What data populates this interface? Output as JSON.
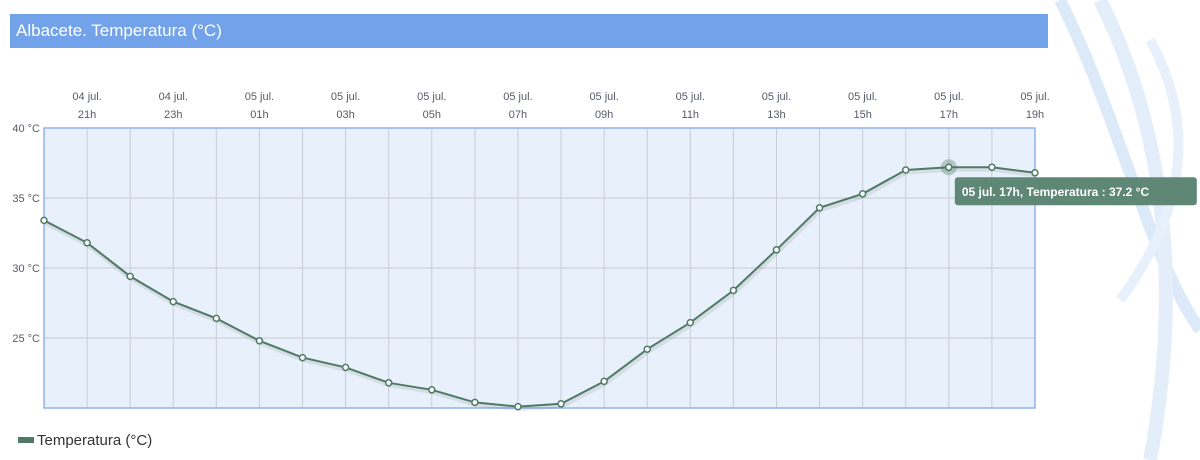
{
  "title": "Albacete. Temperatura (°C)",
  "legend": {
    "label": "Temperatura (°C)"
  },
  "tooltip": {
    "text": "05 jul. 17h, Temperatura : 37.2 °C",
    "point_index": 21
  },
  "colors": {
    "header": "#72a2ea",
    "plot_background": "#e8f0fb",
    "plot_border": "#8fb3ee",
    "grid": "#c7cdd6",
    "series": "#4f7b66",
    "tooltip": "#5e8776"
  },
  "chart_data": {
    "type": "line",
    "y_tick_labels": [
      "40 °C",
      "35 °C",
      "30 °C",
      "25 °C"
    ],
    "y_ticks": [
      40,
      35,
      30,
      25
    ],
    "ylim": [
      20.0,
      40.0
    ],
    "x_tick_labels": [
      {
        "day": "04 jul.",
        "hour": "21h"
      },
      {
        "day": "04 jul.",
        "hour": "23h"
      },
      {
        "day": "05 jul.",
        "hour": "01h"
      },
      {
        "day": "05 jul.",
        "hour": "03h"
      },
      {
        "day": "05 jul.",
        "hour": "05h"
      },
      {
        "day": "05 jul.",
        "hour": "07h"
      },
      {
        "day": "05 jul.",
        "hour": "09h"
      },
      {
        "day": "05 jul.",
        "hour": "11h"
      },
      {
        "day": "05 jul.",
        "hour": "13h"
      },
      {
        "day": "05 jul.",
        "hour": "15h"
      },
      {
        "day": "05 jul.",
        "hour": "17h"
      },
      {
        "day": "05 jul.",
        "hour": "19h"
      }
    ],
    "x": [
      "04 jul. 20h",
      "04 jul. 21h",
      "04 jul. 22h",
      "04 jul. 23h",
      "05 jul. 00h",
      "05 jul. 01h",
      "05 jul. 02h",
      "05 jul. 03h",
      "05 jul. 04h",
      "05 jul. 05h",
      "05 jul. 06h",
      "05 jul. 07h",
      "05 jul. 08h",
      "05 jul. 09h",
      "05 jul. 10h",
      "05 jul. 11h",
      "05 jul. 12h",
      "05 jul. 13h",
      "05 jul. 14h",
      "05 jul. 15h",
      "05 jul. 16h",
      "05 jul. 17h",
      "05 jul. 18h",
      "05 jul. 19h"
    ],
    "series": [
      {
        "name": "Temperatura (°C)",
        "values": [
          33.4,
          31.8,
          29.4,
          27.6,
          26.4,
          24.8,
          23.6,
          22.9,
          21.8,
          21.3,
          20.4,
          20.1,
          20.3,
          21.9,
          24.2,
          26.1,
          28.4,
          31.3,
          34.3,
          35.3,
          37.0,
          37.2,
          37.2,
          36.8
        ]
      }
    ],
    "grid": true,
    "legend_position": "bottom-left"
  }
}
